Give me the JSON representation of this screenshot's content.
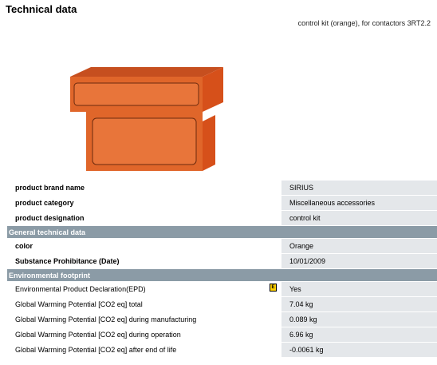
{
  "header": {
    "title": "Technical data",
    "subtitle": "control kit (orange), for contactors 3RT2.2"
  },
  "product": {
    "image_icon": "product-render-control-kit-orange",
    "image_color": "#e0662a"
  },
  "rows_top": [
    {
      "label": "product brand name",
      "value": "SIRIUS"
    },
    {
      "label": "product category",
      "value": "Miscellaneous accessories"
    },
    {
      "label": "product designation",
      "value": "control kit"
    }
  ],
  "sections": {
    "general": "General technical data",
    "environment": "Environmental footprint"
  },
  "rows_general": [
    {
      "label": "color",
      "value": "Orange"
    },
    {
      "label": "Substance Prohibitance (Date)",
      "value": "10/01/2009"
    }
  ],
  "rows_env": [
    {
      "label": "Environmental Product Declaration(EPD)",
      "value": "Yes",
      "icon": "E"
    },
    {
      "label": "Global Warming Potential [CO2 eq] total",
      "value": "7.04 kg"
    },
    {
      "label": "Global Warming Potential [CO2 eq] during manufacturing",
      "value": "0.089 kg"
    },
    {
      "label": "Global Warming Potential [CO2 eq] during operation",
      "value": "6.96 kg"
    },
    {
      "label": "Global Warming Potential [CO2 eq] after end of life",
      "value": "-0.0061 kg"
    }
  ],
  "colors": {
    "section_header_bg": "#8b9ba6",
    "value_cell_bg": "#e4e7ea"
  }
}
